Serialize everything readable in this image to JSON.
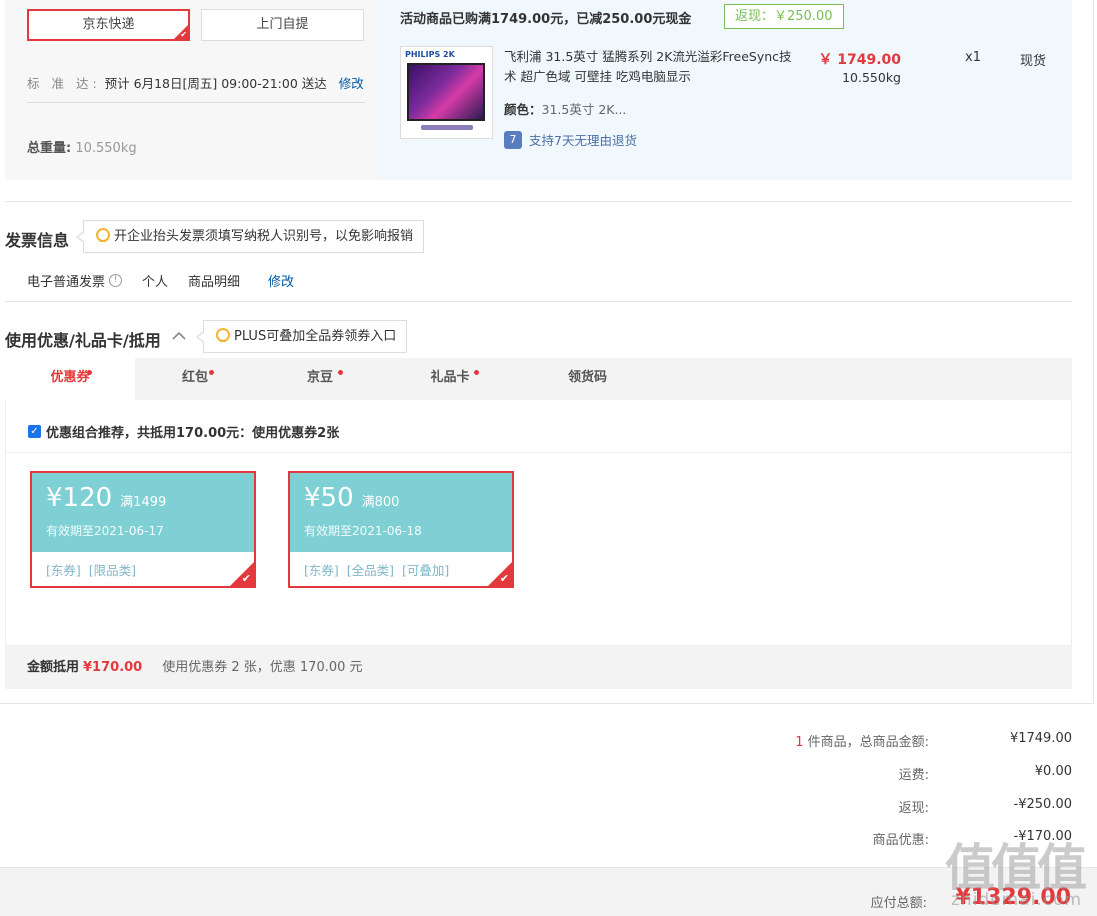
{
  "shipping": {
    "jd_express": "京东快递",
    "self_pickup": "上门自提",
    "standard_label": "标 准 达:",
    "standard_text": "预计 6月18日[周五] 09:00-21:00 送达",
    "modify": "修改",
    "weight_label": "总重量:",
    "weight_value": "10.550kg"
  },
  "promo": {
    "header": "活动商品已购满1749.00元，已减250.00元现金",
    "badge": "返现：￥250.00"
  },
  "product": {
    "image_brand": "PHILIPS 2K",
    "name": "飞利浦 31.5英寸 猛腾系列 2K流光溢彩FreeSync技术 超广色域 可壁挂 吃鸡电脑显示",
    "color_label": "颜色：",
    "color_value": "31.5英寸 2K...",
    "return_icon": "7",
    "return_policy": "支持7天无理由退货",
    "price": "￥ 1749.00",
    "weight": "10.550kg",
    "qty": "x1",
    "stock": "现货"
  },
  "invoice": {
    "title": "发票信息",
    "tip": "开企业抬头发票须填写纳税人识别号，以免影响报销",
    "type": "电子普通发票",
    "info_icon": "!",
    "payer": "个人",
    "content": "商品明细",
    "modify": "修改"
  },
  "coupon_section": {
    "title": "使用优惠/礼品卡/抵用",
    "tip": "PLUS可叠加全品券领券入口",
    "tabs": [
      "优惠券",
      "红包",
      "京豆",
      "礼品卡",
      "领货码"
    ],
    "recommend": "优惠组合推荐，共抵用170.00元：使用优惠券2张",
    "coupons": [
      {
        "amount": "¥120",
        "condition": "满1499",
        "valid": "有效期至2021-06-17",
        "tags": [
          "[东券]",
          "[限品类]"
        ]
      },
      {
        "amount": "¥50",
        "condition": "满800",
        "valid": "有效期至2021-06-18",
        "tags": [
          "[东券]",
          "[全品类]",
          "[可叠加]"
        ]
      }
    ],
    "footer_label": "金额抵用",
    "footer_amount": "¥170.00",
    "footer_desc": "使用优惠券 2 张，优惠 170.00 元"
  },
  "summary": {
    "count": "1",
    "count_suffix": "件商品，总商品金额:",
    "total_goods": "¥1749.00",
    "shipping_label": "运费:",
    "shipping_value": "¥0.00",
    "rebate_label": "返现:",
    "rebate_value": "-¥250.00",
    "discount_label": "商品优惠:",
    "discount_value": "-¥170.00",
    "pay_label": "应付总额:",
    "pay_amount": "¥1329.00"
  },
  "watermark": {
    "glyph": "值值值",
    "text": "zhidemai.com"
  },
  "colors": {
    "accent_red": "#e4393c",
    "link_blue": "#005aa0",
    "rebate_green": "#7abd54",
    "coupon_teal": "#7fd0d4"
  }
}
